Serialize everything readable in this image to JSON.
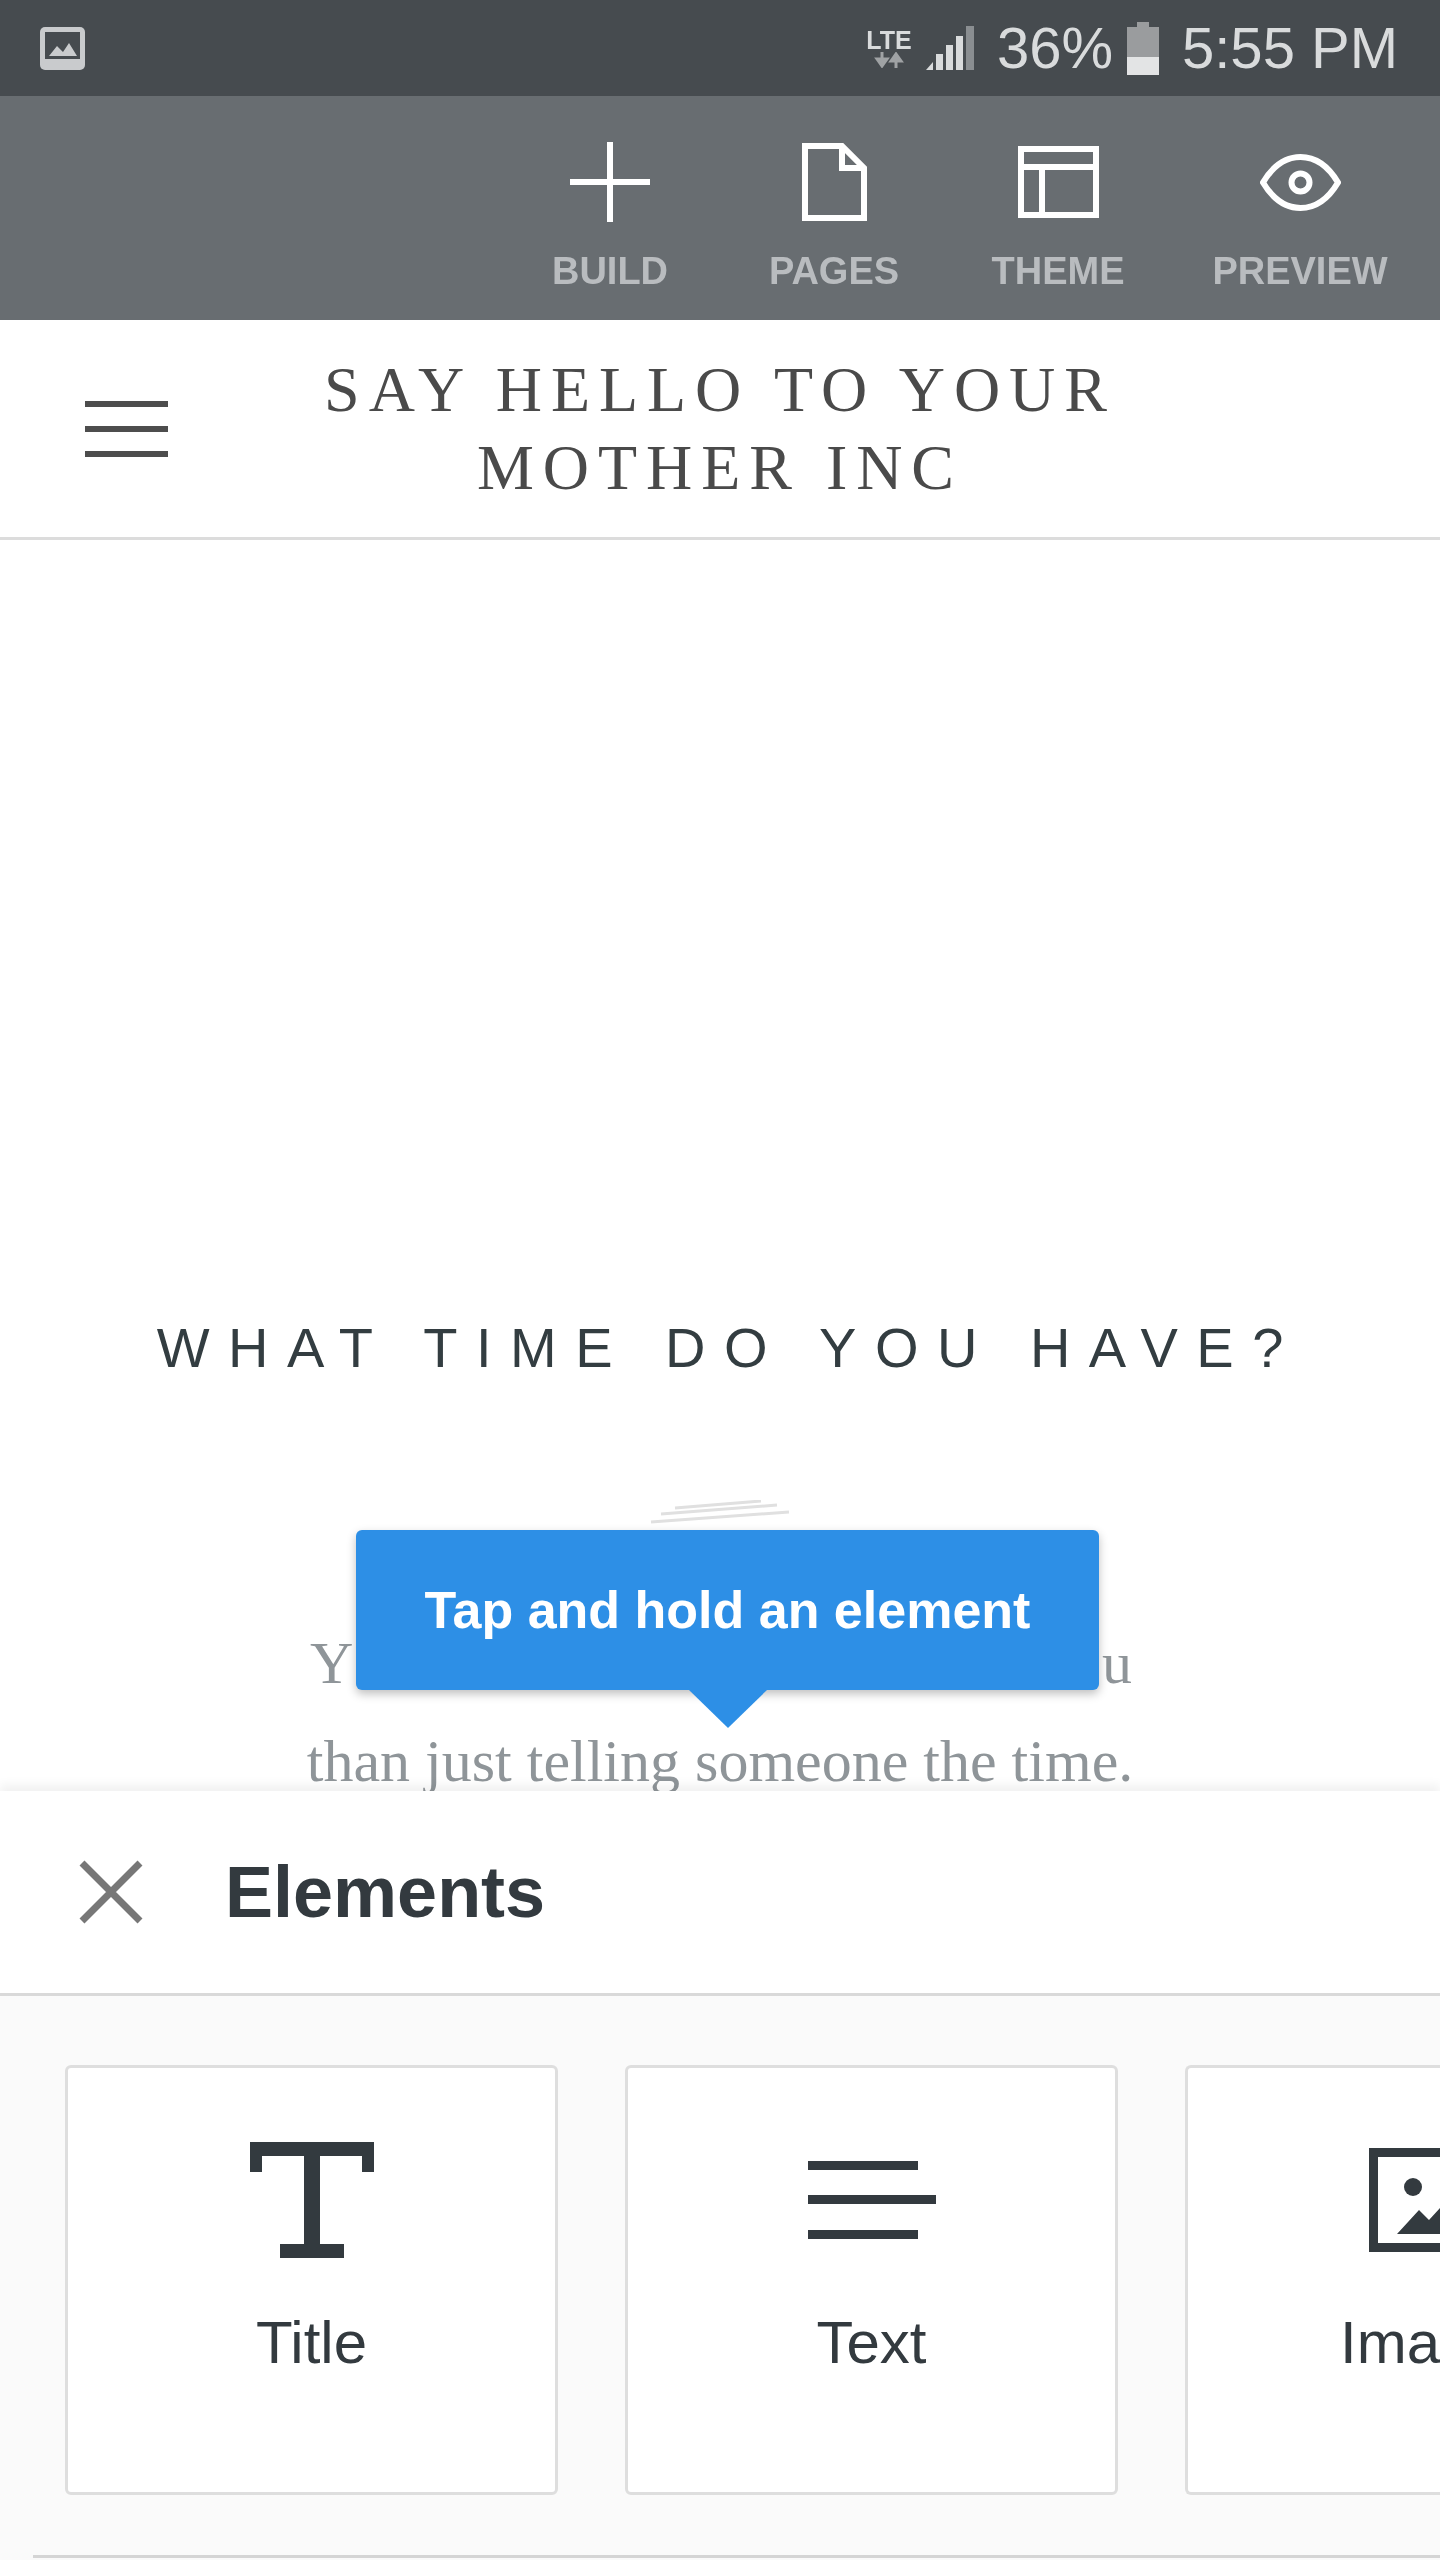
{
  "status_bar": {
    "network": "LTE",
    "battery": "36%",
    "time": "5:55 PM"
  },
  "toolbar": {
    "items": [
      {
        "kind": "build",
        "label": "BUILD"
      },
      {
        "kind": "pages",
        "label": "PAGES"
      },
      {
        "kind": "theme",
        "label": "THEME"
      },
      {
        "kind": "preview",
        "label": "PREVIEW"
      }
    ]
  },
  "site_header": {
    "title": "SAY HELLO TO YOUR MOTHER INC"
  },
  "section": {
    "heading": "WHAT TIME DO YOU HAVE?",
    "paragraph_lines": [
      {
        "fragments": [
          "Y",
          "u"
        ]
      },
      {
        "fragments": [
          "than just telling someone the time."
        ]
      }
    ]
  },
  "tooltip": {
    "text": "Tap and hold an element"
  },
  "elements_panel": {
    "title": "Elements",
    "items": [
      {
        "kind": "title",
        "label": "Title"
      },
      {
        "kind": "text",
        "label": "Text"
      },
      {
        "kind": "image",
        "label": "Ima"
      }
    ]
  }
}
